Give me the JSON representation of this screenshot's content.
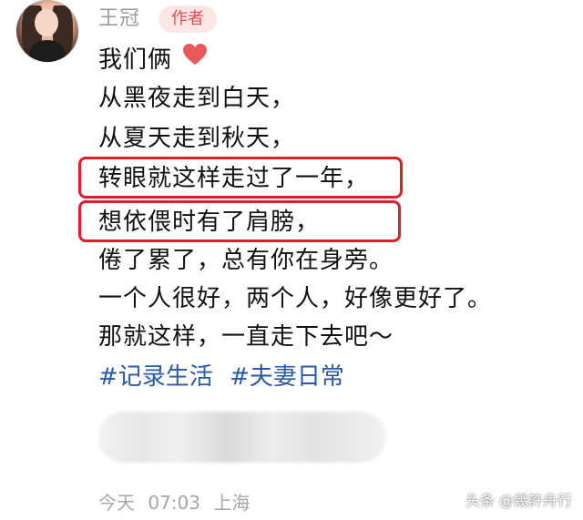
{
  "author": {
    "name": "王冠",
    "badge": "作者"
  },
  "post": {
    "line1_text": "我们俩",
    "line2": "从黑夜走到白天，",
    "line3": "从夏天走到秋天，",
    "line4": "转眼就这样走过了一年，",
    "line5": "想依偎时有了肩膀，",
    "line6": "倦了累了，总有你在身旁。",
    "line7": "一个人很好，两个人，好像更好了。",
    "line8": "那就这样，一直走下去吧～"
  },
  "tags": [
    "#记录生活",
    "#夫妻日常"
  ],
  "meta": {
    "date": "今天",
    "time": "07:03",
    "location": "上海"
  },
  "watermark": "头条 @幾許舟行",
  "colors": {
    "text": "#111111",
    "name_gray": "#9b9b9b",
    "badge_bg": "#fde6e6",
    "badge_text": "#e34d4d",
    "tag_blue": "#2a5aa6",
    "highlight_red": "#e01e28",
    "heart_red": "#e85a5a"
  },
  "icons": {
    "heart": "heart-icon"
  }
}
